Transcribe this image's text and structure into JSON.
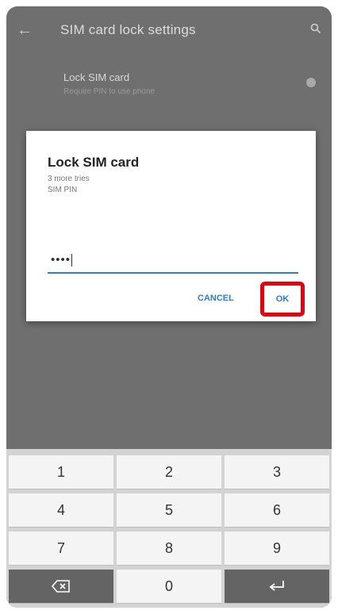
{
  "app_bar": {
    "title": "SIM card lock settings",
    "back_icon": "back-arrow-icon",
    "search_icon": "search-icon"
  },
  "preference": {
    "title": "Lock SIM card",
    "subtitle": "Require PIN to use phone"
  },
  "dialog": {
    "title": "Lock SIM card",
    "tries_text": "3 more tries",
    "label": "SIM PIN",
    "pin_value": "••••",
    "cancel_label": "CANCEL",
    "ok_label": "OK",
    "highlight_color": "#e3000f",
    "accent_color": "#2b7cd3"
  },
  "keypad": {
    "keys": [
      "1",
      "2",
      "3",
      "4",
      "5",
      "6",
      "7",
      "8",
      "9",
      "0"
    ],
    "backspace_icon": "backspace-icon",
    "enter_icon": "enter-icon"
  }
}
